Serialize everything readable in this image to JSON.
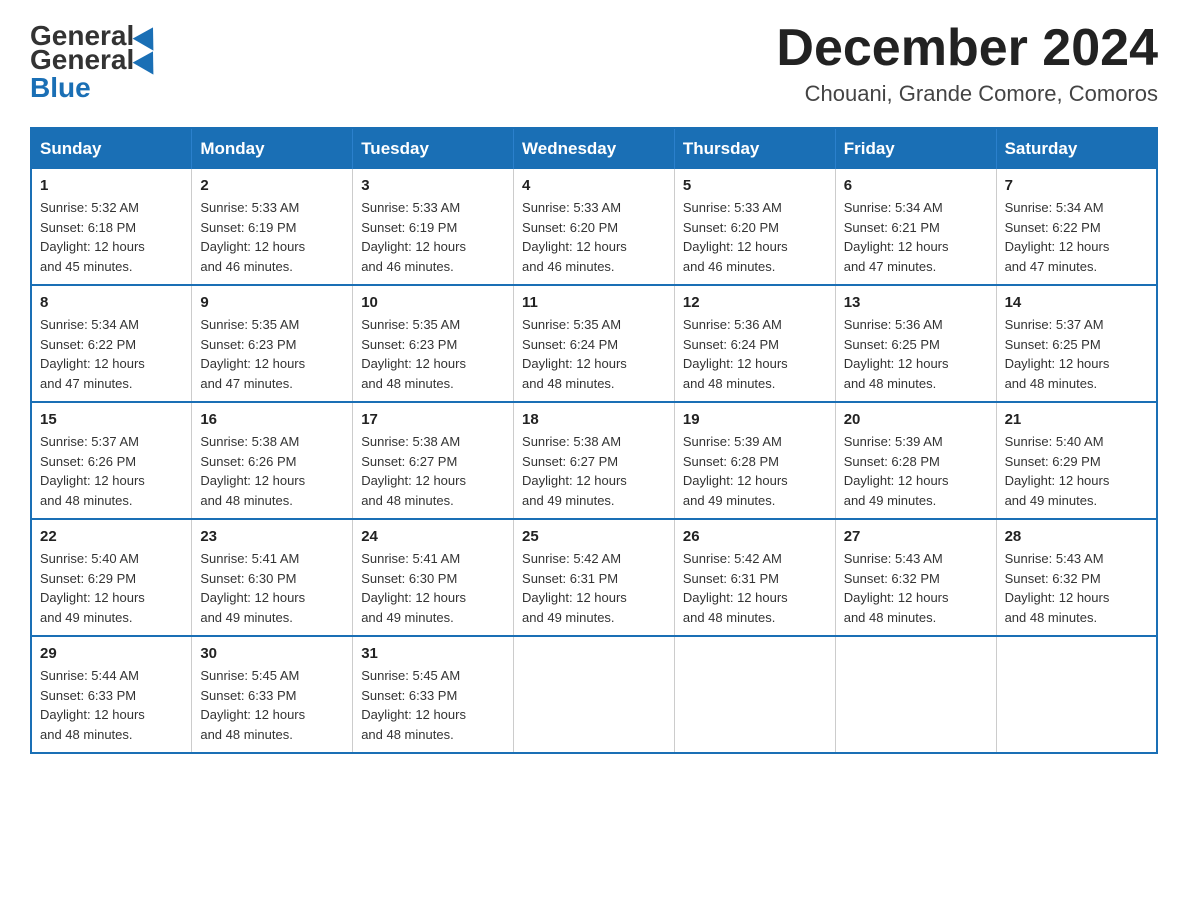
{
  "header": {
    "logo_general": "General",
    "logo_blue": "Blue",
    "month_title": "December 2024",
    "location": "Chouani, Grande Comore, Comoros"
  },
  "days_of_week": [
    "Sunday",
    "Monday",
    "Tuesday",
    "Wednesday",
    "Thursday",
    "Friday",
    "Saturday"
  ],
  "weeks": [
    [
      {
        "day": 1,
        "sunrise": "5:32 AM",
        "sunset": "6:18 PM",
        "daylight": "12 hours and 45 minutes."
      },
      {
        "day": 2,
        "sunrise": "5:33 AM",
        "sunset": "6:19 PM",
        "daylight": "12 hours and 46 minutes."
      },
      {
        "day": 3,
        "sunrise": "5:33 AM",
        "sunset": "6:19 PM",
        "daylight": "12 hours and 46 minutes."
      },
      {
        "day": 4,
        "sunrise": "5:33 AM",
        "sunset": "6:20 PM",
        "daylight": "12 hours and 46 minutes."
      },
      {
        "day": 5,
        "sunrise": "5:33 AM",
        "sunset": "6:20 PM",
        "daylight": "12 hours and 46 minutes."
      },
      {
        "day": 6,
        "sunrise": "5:34 AM",
        "sunset": "6:21 PM",
        "daylight": "12 hours and 47 minutes."
      },
      {
        "day": 7,
        "sunrise": "5:34 AM",
        "sunset": "6:22 PM",
        "daylight": "12 hours and 47 minutes."
      }
    ],
    [
      {
        "day": 8,
        "sunrise": "5:34 AM",
        "sunset": "6:22 PM",
        "daylight": "12 hours and 47 minutes."
      },
      {
        "day": 9,
        "sunrise": "5:35 AM",
        "sunset": "6:23 PM",
        "daylight": "12 hours and 47 minutes."
      },
      {
        "day": 10,
        "sunrise": "5:35 AM",
        "sunset": "6:23 PM",
        "daylight": "12 hours and 48 minutes."
      },
      {
        "day": 11,
        "sunrise": "5:35 AM",
        "sunset": "6:24 PM",
        "daylight": "12 hours and 48 minutes."
      },
      {
        "day": 12,
        "sunrise": "5:36 AM",
        "sunset": "6:24 PM",
        "daylight": "12 hours and 48 minutes."
      },
      {
        "day": 13,
        "sunrise": "5:36 AM",
        "sunset": "6:25 PM",
        "daylight": "12 hours and 48 minutes."
      },
      {
        "day": 14,
        "sunrise": "5:37 AM",
        "sunset": "6:25 PM",
        "daylight": "12 hours and 48 minutes."
      }
    ],
    [
      {
        "day": 15,
        "sunrise": "5:37 AM",
        "sunset": "6:26 PM",
        "daylight": "12 hours and 48 minutes."
      },
      {
        "day": 16,
        "sunrise": "5:38 AM",
        "sunset": "6:26 PM",
        "daylight": "12 hours and 48 minutes."
      },
      {
        "day": 17,
        "sunrise": "5:38 AM",
        "sunset": "6:27 PM",
        "daylight": "12 hours and 48 minutes."
      },
      {
        "day": 18,
        "sunrise": "5:38 AM",
        "sunset": "6:27 PM",
        "daylight": "12 hours and 49 minutes."
      },
      {
        "day": 19,
        "sunrise": "5:39 AM",
        "sunset": "6:28 PM",
        "daylight": "12 hours and 49 minutes."
      },
      {
        "day": 20,
        "sunrise": "5:39 AM",
        "sunset": "6:28 PM",
        "daylight": "12 hours and 49 minutes."
      },
      {
        "day": 21,
        "sunrise": "5:40 AM",
        "sunset": "6:29 PM",
        "daylight": "12 hours and 49 minutes."
      }
    ],
    [
      {
        "day": 22,
        "sunrise": "5:40 AM",
        "sunset": "6:29 PM",
        "daylight": "12 hours and 49 minutes."
      },
      {
        "day": 23,
        "sunrise": "5:41 AM",
        "sunset": "6:30 PM",
        "daylight": "12 hours and 49 minutes."
      },
      {
        "day": 24,
        "sunrise": "5:41 AM",
        "sunset": "6:30 PM",
        "daylight": "12 hours and 49 minutes."
      },
      {
        "day": 25,
        "sunrise": "5:42 AM",
        "sunset": "6:31 PM",
        "daylight": "12 hours and 49 minutes."
      },
      {
        "day": 26,
        "sunrise": "5:42 AM",
        "sunset": "6:31 PM",
        "daylight": "12 hours and 48 minutes."
      },
      {
        "day": 27,
        "sunrise": "5:43 AM",
        "sunset": "6:32 PM",
        "daylight": "12 hours and 48 minutes."
      },
      {
        "day": 28,
        "sunrise": "5:43 AM",
        "sunset": "6:32 PM",
        "daylight": "12 hours and 48 minutes."
      }
    ],
    [
      {
        "day": 29,
        "sunrise": "5:44 AM",
        "sunset": "6:33 PM",
        "daylight": "12 hours and 48 minutes."
      },
      {
        "day": 30,
        "sunrise": "5:45 AM",
        "sunset": "6:33 PM",
        "daylight": "12 hours and 48 minutes."
      },
      {
        "day": 31,
        "sunrise": "5:45 AM",
        "sunset": "6:33 PM",
        "daylight": "12 hours and 48 minutes."
      },
      null,
      null,
      null,
      null
    ]
  ],
  "labels": {
    "sunrise": "Sunrise:",
    "sunset": "Sunset:",
    "daylight": "Daylight:"
  }
}
